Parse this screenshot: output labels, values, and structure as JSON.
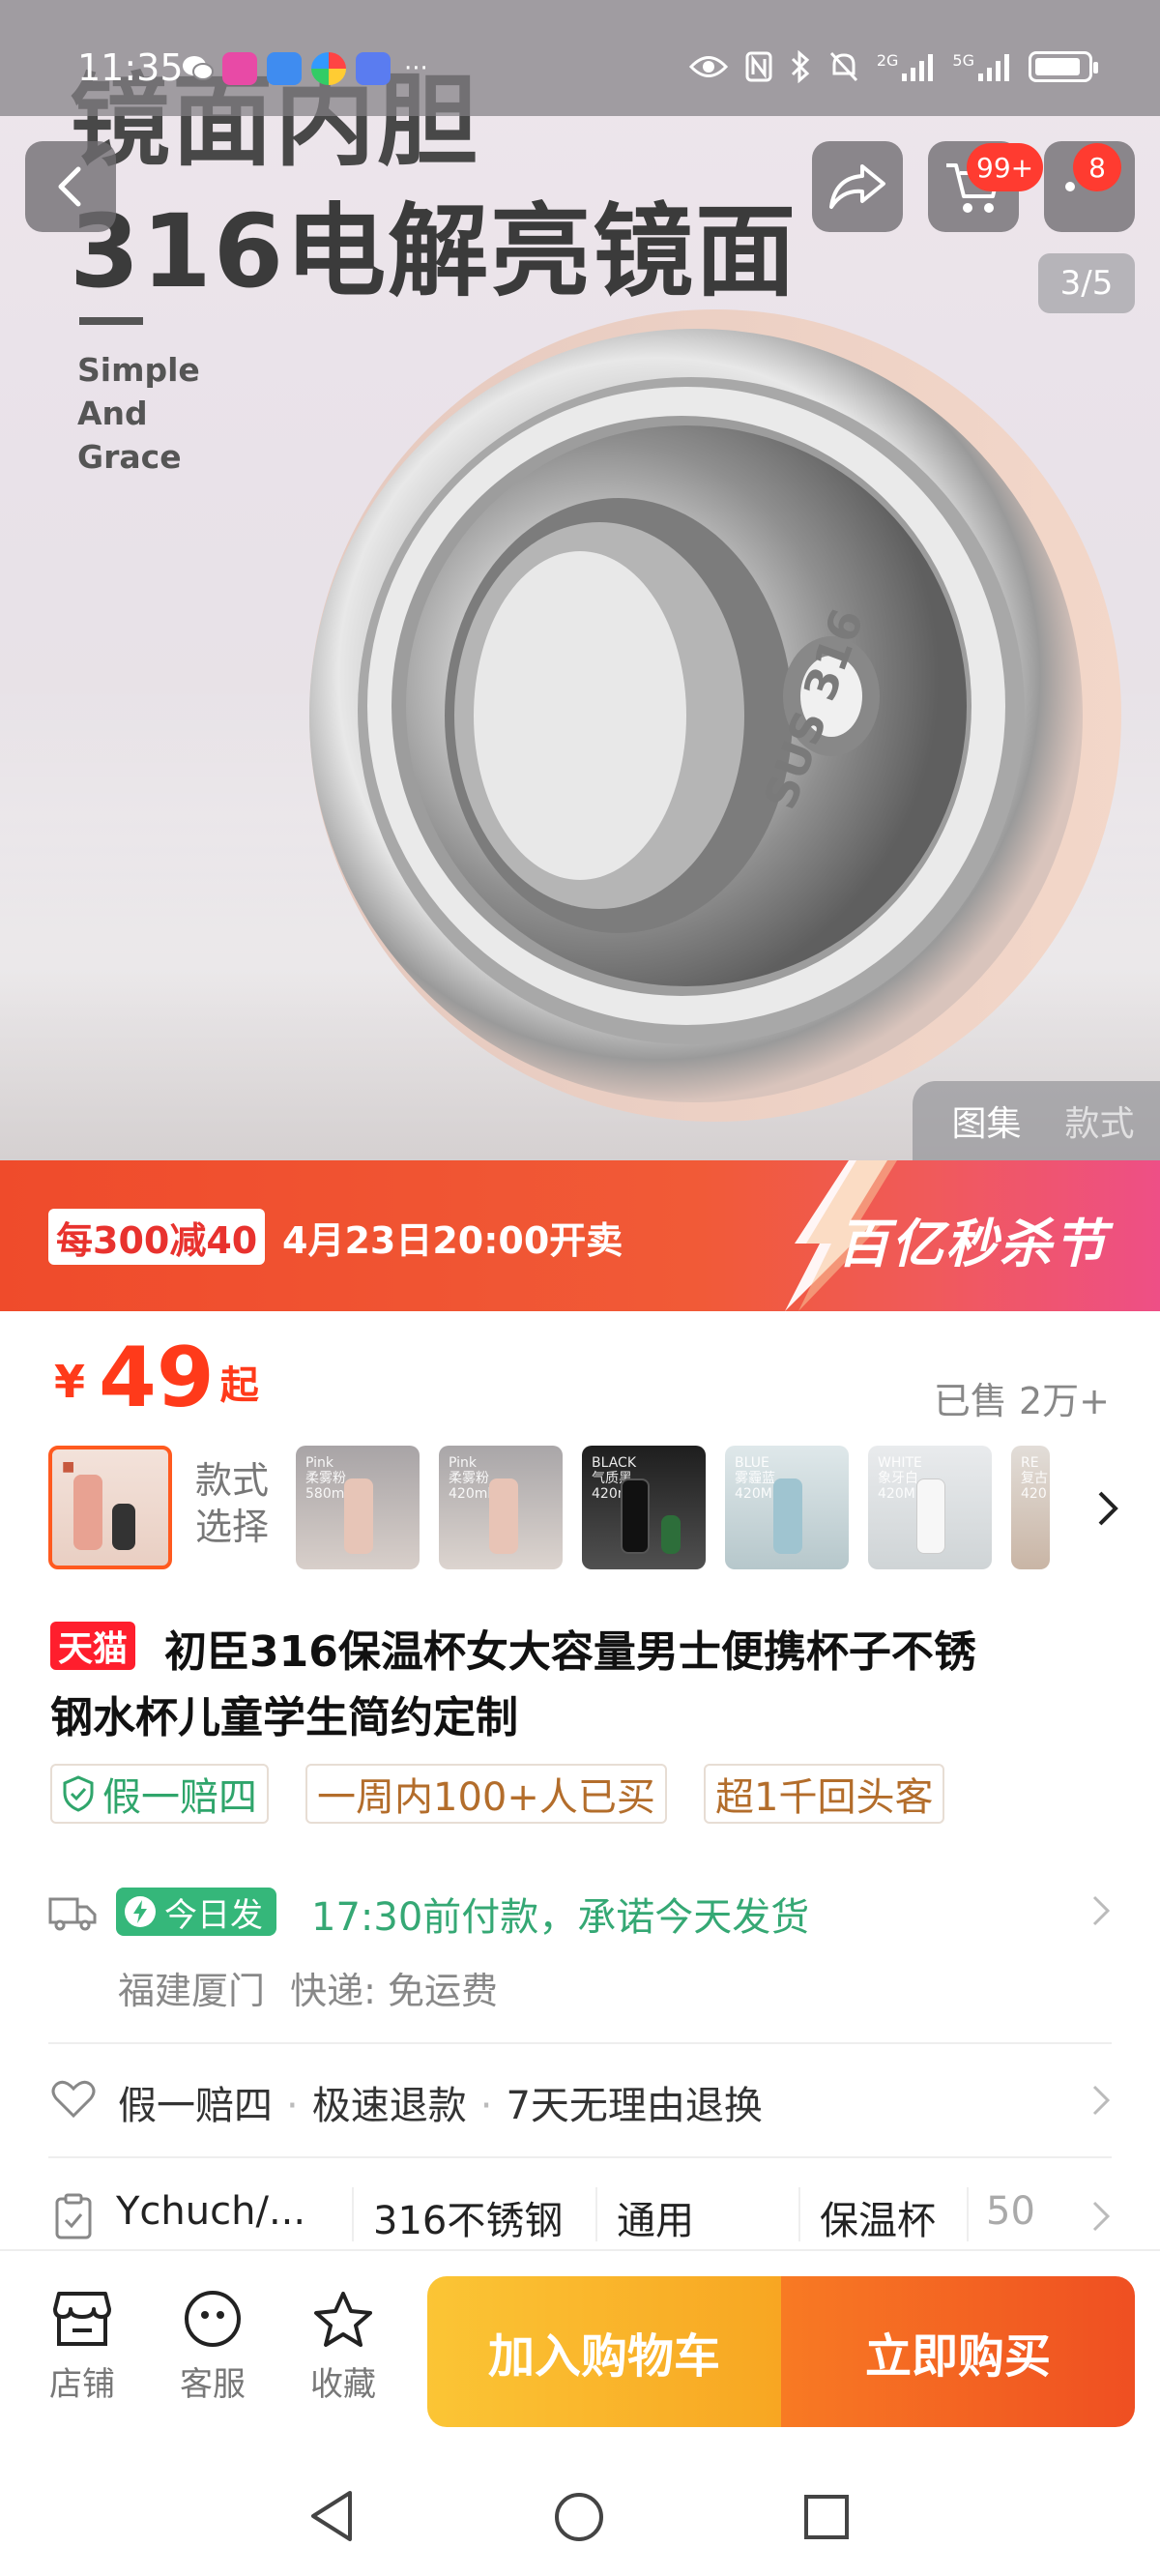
{
  "status_bar": {
    "time": "11:35",
    "dots": "···",
    "network_1": "2G",
    "network_2": "5G"
  },
  "hero": {
    "heading_line1": "镜面内胆",
    "heading_line2": "316电解亮镜面",
    "tagline": [
      "Simple",
      "And",
      "Grace"
    ],
    "engraving": "SUS 316",
    "counter": "3/5",
    "gallery_tabs": [
      "图集",
      "款式"
    ]
  },
  "header": {
    "cart_badge": "99+",
    "more_badge": "8"
  },
  "promo": {
    "tag": "每300减40",
    "date": "4月23日20:00开卖",
    "event": "百亿秒杀节"
  },
  "price": {
    "currency": "¥",
    "value": "49",
    "suffix": "起",
    "sold": "已售 2万+"
  },
  "variants": {
    "label_line1": "款式",
    "label_line2": "选择",
    "thumbs": [
      {
        "text": "",
        "color": "#e9a08e"
      },
      {
        "text": "Pink\n柔雾粉\n580ml",
        "color": "#e7c5b7"
      },
      {
        "text": "Pink\n柔雾粉\n420ml",
        "color": "#e8c4b6"
      },
      {
        "text": "BLACK\n气质黑\n420ml",
        "color": "#2b2b2b"
      },
      {
        "text": "BLUE\n雾霾蓝\n420ML",
        "color": "#9fc4d0"
      },
      {
        "text": "WHITE\n象牙白\n420ML",
        "color": "#f2f2f2"
      },
      {
        "text": "RE\n复古\n420",
        "color": "#d9a57a"
      }
    ]
  },
  "product": {
    "store_badge": "天猫",
    "title_line1": "初臣316保温杯女大容量男士便携杯子不锈",
    "title_line2": "钢水杯儿童学生简约定制",
    "tags": [
      "假一赔四",
      "一周内100+人已买",
      "超1千回头客"
    ]
  },
  "delivery": {
    "pill": "今日发",
    "promise": "17:30前付款，承诺今天发货",
    "origin": "福建厦门",
    "shipping": "快递: 免运费"
  },
  "guarantee": [
    "假一赔四",
    "极速退款",
    "7天无理由退换"
  ],
  "params": [
    "Ychuch/...",
    "316不锈钢",
    "通用",
    "保温杯",
    "50"
  ],
  "bottom_bar": {
    "store": "店铺",
    "service": "客服",
    "favorite": "收藏",
    "add_to_cart": "加入购物车",
    "buy_now": "立即购买"
  },
  "colors": {
    "accent": "#ff3a1a",
    "promo": "#ef4b2b",
    "green": "#35b77a",
    "cart_button": "#f8a622",
    "buy_button": "#ef4f22"
  }
}
